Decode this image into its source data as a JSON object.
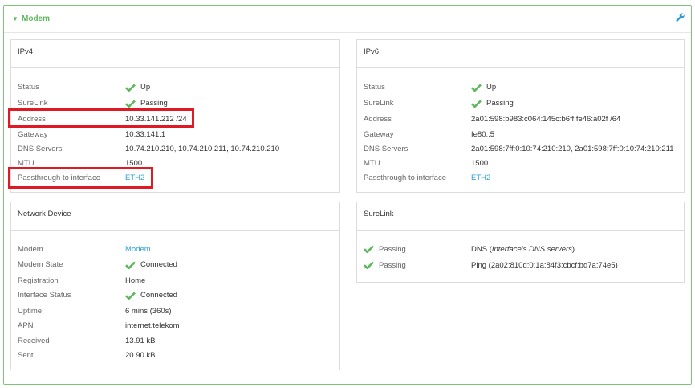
{
  "section": {
    "title": "Modem",
    "toggle_icon": "triangle-down-icon",
    "settings_icon": "wrench-icon",
    "accent_color": "#5cb85c"
  },
  "ipv4": {
    "title": "IPv4",
    "rows": [
      {
        "label": "Status",
        "value": "Up",
        "icon": "check-icon"
      },
      {
        "label": "SureLink",
        "value": "Passing",
        "icon": "check-icon"
      },
      {
        "label": "Address",
        "value": "10.33.141.212 /24"
      },
      {
        "label": "Gateway",
        "value": "10.33.141.1"
      },
      {
        "label": "DNS Servers",
        "value": "10.74.210.210, 10.74.210.211, 10.74.210.210"
      },
      {
        "label": "MTU",
        "value": "1500"
      },
      {
        "label": "Passthrough to interface",
        "value": "ETH2",
        "link": true
      }
    ]
  },
  "ipv6": {
    "title": "IPv6",
    "rows": [
      {
        "label": "Status",
        "value": "Up",
        "icon": "check-icon"
      },
      {
        "label": "SureLink",
        "value": "Passing",
        "icon": "check-icon"
      },
      {
        "label": "Address",
        "value": "2a01:598:b983:c064:145c:b6ff:fe46:a02f /64"
      },
      {
        "label": "Gateway",
        "value": "fe80::5"
      },
      {
        "label": "DNS Servers",
        "value": "2a01:598:7ff:0:10:74:210:210, 2a01:598:7ff:0:10:74:210:211"
      },
      {
        "label": "MTU",
        "value": "1500"
      },
      {
        "label": "Passthrough to interface",
        "value": "ETH2",
        "link": true
      }
    ]
  },
  "network_device": {
    "title": "Network Device",
    "rows": [
      {
        "label": "Modem",
        "value": "Modem",
        "link": true
      },
      {
        "label": "Modem State",
        "value": "Connected",
        "icon": "check-icon"
      },
      {
        "label": "Registration",
        "value": "Home"
      },
      {
        "label": "Interface Status",
        "value": "Connected",
        "icon": "check-icon"
      },
      {
        "label": "Uptime",
        "value": "6 mins (360s)"
      },
      {
        "label": "APN",
        "value": "internet.telekom"
      },
      {
        "label": "Received",
        "value": "13.91 kB"
      },
      {
        "label": "Sent",
        "value": "20.90 kB"
      }
    ]
  },
  "surelink": {
    "title": "SureLink",
    "tests": [
      {
        "status": "Passing",
        "test": "DNS",
        "detail": "Interface's DNS servers"
      },
      {
        "status": "Passing",
        "test": "Ping (2a02:810d:0:1a:84f3:cbcf:bd7a:74e5)"
      }
    ]
  },
  "colors": {
    "check": "#5cb85c",
    "link": "#2a9fd6",
    "highlight": "#e01a24"
  }
}
